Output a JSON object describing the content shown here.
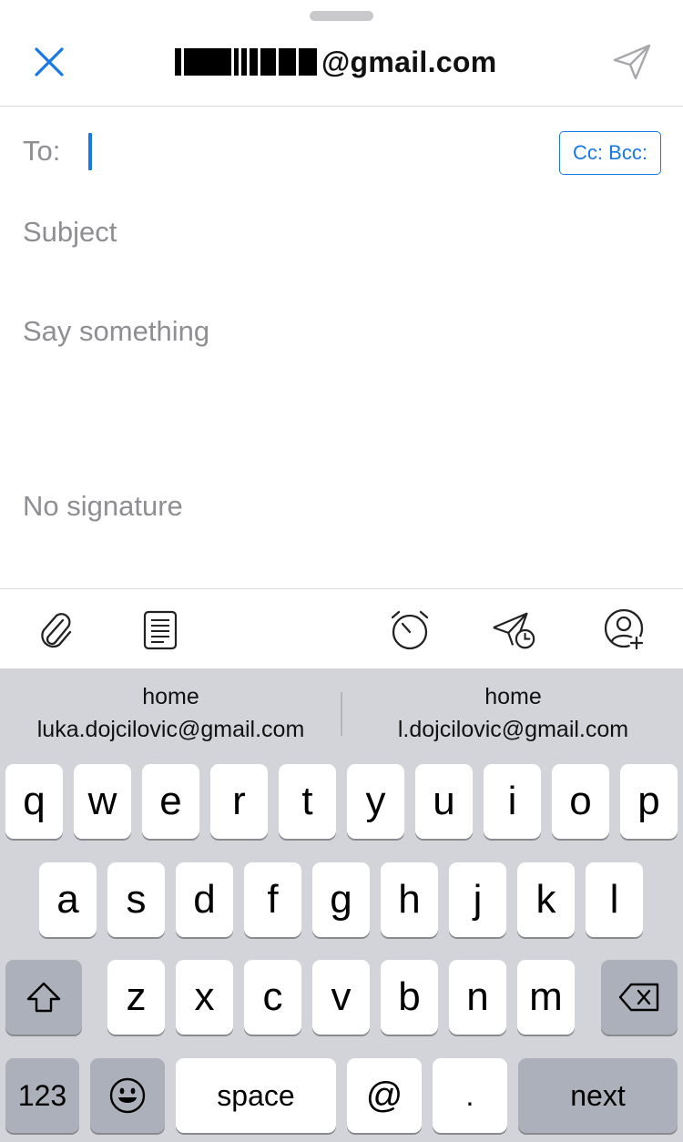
{
  "header": {
    "from_suffix": "@gmail.com",
    "close_icon": "close-icon",
    "send_icon": "send-icon"
  },
  "compose": {
    "to_label": "To:",
    "cc_bcc_label": "Cc: Bcc:",
    "subject_placeholder": "Subject",
    "body_placeholder": "Say something",
    "signature": "No signature"
  },
  "toolbar": {
    "icons": [
      "paperclip-icon",
      "template-icon",
      "alarm-clock-icon",
      "scheduled-send-icon",
      "add-contact-icon"
    ]
  },
  "suggestions": [
    {
      "label": "home",
      "email": "luka.dojcilovic@gmail.com"
    },
    {
      "label": "home",
      "email": "l.dojcilovic@gmail.com"
    }
  ],
  "keyboard": {
    "row1": [
      "q",
      "w",
      "e",
      "r",
      "t",
      "y",
      "u",
      "i",
      "o",
      "p"
    ],
    "row2": [
      "a",
      "s",
      "d",
      "f",
      "g",
      "h",
      "j",
      "k",
      "l"
    ],
    "row3": [
      "z",
      "x",
      "c",
      "v",
      "b",
      "n",
      "m"
    ],
    "numbers_key": "123",
    "space_key": "space",
    "at_key": "@",
    "dot_key": ".",
    "next_key": "next"
  },
  "colors": {
    "accent": "#1778e6",
    "keyboard_bg": "#d2d4d9",
    "placeholder": "#8e8e93"
  }
}
